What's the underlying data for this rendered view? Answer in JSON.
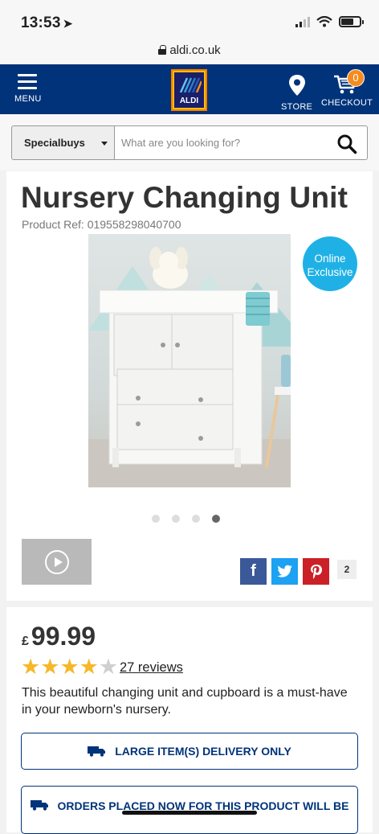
{
  "status": {
    "time": "13:53"
  },
  "browser": {
    "url": "aldi.co.uk"
  },
  "nav": {
    "menu_label": "MENU",
    "logo_text": "ALDI",
    "store_label": "STORE",
    "checkout_label": "CHECKOUT",
    "cart_count": "0"
  },
  "search": {
    "category": "Specialbuys",
    "placeholder": "What are you looking for?"
  },
  "product": {
    "title": "Nursery Changing Unit",
    "ref": "Product Ref: 019558298040700",
    "badge_line1": "Online",
    "badge_line2": "Exclusive",
    "carousel": {
      "count": 4,
      "active_index": 3
    },
    "share_count": "2"
  },
  "pricing": {
    "currency": "£",
    "price": "99.99",
    "rating": 4,
    "rating_max": 5,
    "reviews": "27 reviews",
    "description": "This beautiful changing unit and cupboard is a must-have in your newborn's nursery.",
    "delivery_banner": "LARGE ITEM(S) DELIVERY ONLY",
    "orders_banner": "ORDERS PLACED NOW FOR THIS PRODUCT WILL BE"
  },
  "colors": {
    "brand_blue": "#00337a",
    "badge_blue": "#1fb1e6",
    "star": "#f6b828",
    "cart_badge": "#f68b1f"
  }
}
